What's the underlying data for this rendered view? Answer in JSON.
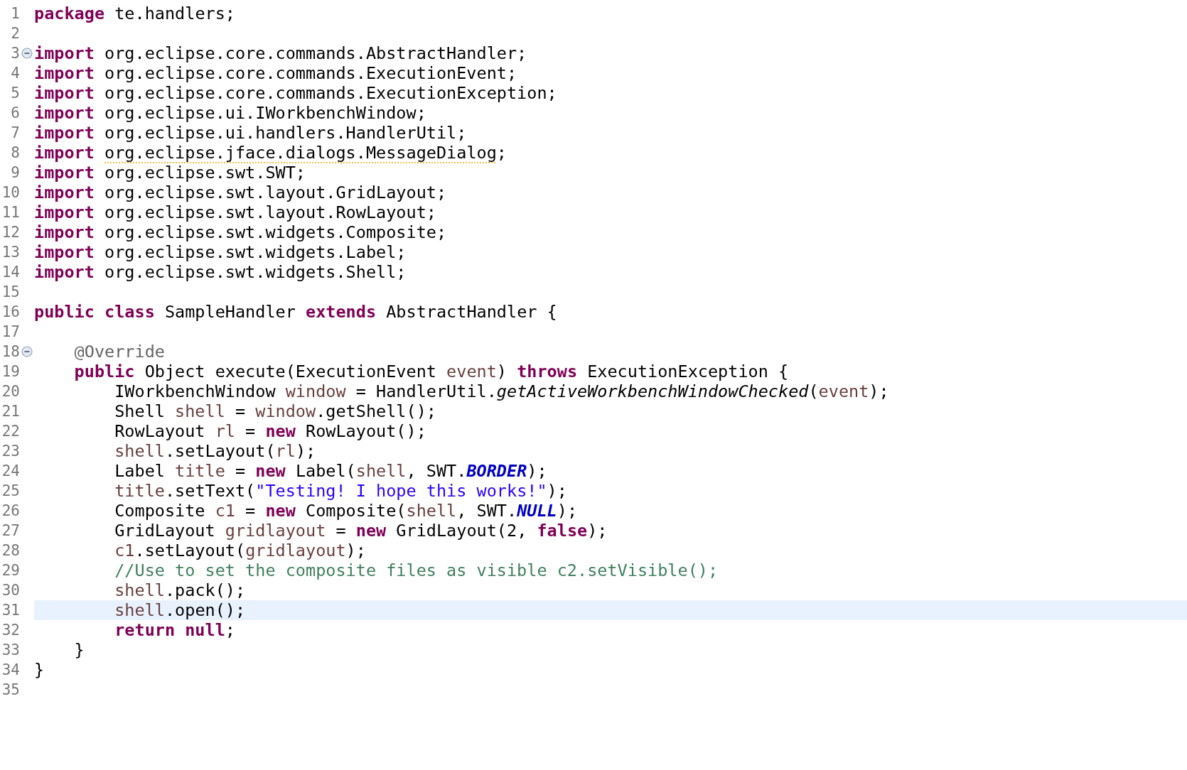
{
  "editor": {
    "lines": [
      {
        "number": "1",
        "fold": false,
        "current": false,
        "tokens": [
          {
            "kind": "keyword",
            "text": "package"
          },
          {
            "kind": "plain",
            "text": " te.handlers;"
          }
        ]
      },
      {
        "number": "2",
        "fold": false,
        "current": false
      },
      {
        "number": "3",
        "fold": true,
        "current": false,
        "tokens": [
          {
            "kind": "keyword",
            "text": "import"
          },
          {
            "kind": "plain",
            "text": " org.eclipse.core.commands.AbstractHandler;"
          }
        ]
      },
      {
        "number": "4",
        "fold": false,
        "current": false,
        "tokens": [
          {
            "kind": "keyword",
            "text": "import"
          },
          {
            "kind": "plain",
            "text": " org.eclipse.core.commands.ExecutionEvent;"
          }
        ]
      },
      {
        "number": "5",
        "fold": false,
        "current": false,
        "tokens": [
          {
            "kind": "keyword",
            "text": "import"
          },
          {
            "kind": "plain",
            "text": " org.eclipse.core.commands.ExecutionException;"
          }
        ]
      },
      {
        "number": "6",
        "fold": false,
        "current": false,
        "tokens": [
          {
            "kind": "keyword",
            "text": "import"
          },
          {
            "kind": "plain",
            "text": " org.eclipse.ui.IWorkbenchWindow;"
          }
        ]
      },
      {
        "number": "7",
        "fold": false,
        "current": false,
        "tokens": [
          {
            "kind": "keyword",
            "text": "import"
          },
          {
            "kind": "plain",
            "text": " org.eclipse.ui.handlers.HandlerUtil;"
          }
        ]
      },
      {
        "number": "8",
        "fold": false,
        "current": false,
        "tokens": [
          {
            "kind": "keyword",
            "text": "import "
          },
          {
            "kind": "warning",
            "text": "org.eclipse.jface.dialogs.MessageDialog"
          },
          {
            "kind": "plain",
            "text": ";"
          }
        ]
      },
      {
        "number": "9",
        "fold": false,
        "current": false,
        "tokens": [
          {
            "kind": "keyword",
            "text": "import"
          },
          {
            "kind": "plain",
            "text": " org.eclipse.swt.SWT;"
          }
        ]
      },
      {
        "number": "10",
        "fold": false,
        "current": false,
        "tokens": [
          {
            "kind": "keyword",
            "text": "import"
          },
          {
            "kind": "plain",
            "text": " org.eclipse.swt.layout.GridLayout;"
          }
        ]
      },
      {
        "number": "11",
        "fold": false,
        "current": false,
        "tokens": [
          {
            "kind": "keyword",
            "text": "import"
          },
          {
            "kind": "plain",
            "text": " org.eclipse.swt.layout.RowLayout;"
          }
        ]
      },
      {
        "number": "12",
        "fold": false,
        "current": false,
        "tokens": [
          {
            "kind": "keyword",
            "text": "import"
          },
          {
            "kind": "plain",
            "text": " org.eclipse.swt.widgets.Composite;"
          }
        ]
      },
      {
        "number": "13",
        "fold": false,
        "current": false,
        "tokens": [
          {
            "kind": "keyword",
            "text": "import"
          },
          {
            "kind": "plain",
            "text": " org.eclipse.swt.widgets.Label;"
          }
        ]
      },
      {
        "number": "14",
        "fold": false,
        "current": false,
        "tokens": [
          {
            "kind": "keyword",
            "text": "import"
          },
          {
            "kind": "plain",
            "text": " org.eclipse.swt.widgets.Shell;"
          }
        ]
      },
      {
        "number": "15",
        "fold": false,
        "current": false
      },
      {
        "number": "16",
        "fold": false,
        "current": false,
        "tokens": [
          {
            "kind": "keyword",
            "text": "public class"
          },
          {
            "kind": "plain",
            "text": " SampleHandler "
          },
          {
            "kind": "keyword",
            "text": "extends"
          },
          {
            "kind": "plain",
            "text": " AbstractHandler {"
          }
        ]
      },
      {
        "number": "17",
        "fold": false,
        "current": false
      },
      {
        "number": "18",
        "fold": true,
        "current": false,
        "tokens": [
          {
            "kind": "annotation",
            "text": "    @Override"
          }
        ]
      },
      {
        "number": "19",
        "fold": false,
        "current": false,
        "tokens": [
          {
            "kind": "keyword",
            "text": "    public"
          },
          {
            "kind": "plain",
            "text": " Object execute(ExecutionEvent "
          },
          {
            "kind": "variable",
            "text": "event"
          },
          {
            "kind": "plain",
            "text": ") "
          },
          {
            "kind": "keyword",
            "text": "throws"
          },
          {
            "kind": "plain",
            "text": " ExecutionException {"
          }
        ]
      },
      {
        "number": "20",
        "fold": false,
        "current": false,
        "tokens": [
          {
            "kind": "plain",
            "text": "        IWorkbenchWindow "
          },
          {
            "kind": "variable",
            "text": "window"
          },
          {
            "kind": "plain",
            "text": " = HandlerUtil."
          },
          {
            "kind": "method",
            "text": "getActiveWorkbenchWindowChecked"
          },
          {
            "kind": "plain",
            "text": "("
          },
          {
            "kind": "variable",
            "text": "event"
          },
          {
            "kind": "plain",
            "text": ");"
          }
        ]
      },
      {
        "number": "21",
        "fold": false,
        "current": false,
        "tokens": [
          {
            "kind": "plain",
            "text": "        Shell "
          },
          {
            "kind": "variable",
            "text": "shell"
          },
          {
            "kind": "plain",
            "text": " = "
          },
          {
            "kind": "variable",
            "text": "window"
          },
          {
            "kind": "plain",
            "text": ".getShell();"
          }
        ]
      },
      {
        "number": "22",
        "fold": false,
        "current": false,
        "tokens": [
          {
            "kind": "plain",
            "text": "        RowLayout "
          },
          {
            "kind": "variable",
            "text": "rl"
          },
          {
            "kind": "plain",
            "text": " = "
          },
          {
            "kind": "keyword",
            "text": "new"
          },
          {
            "kind": "plain",
            "text": " RowLayout();"
          }
        ]
      },
      {
        "number": "23",
        "fold": false,
        "current": false,
        "tokens": [
          {
            "kind": "variable",
            "text": "        shell"
          },
          {
            "kind": "plain",
            "text": ".setLayout("
          },
          {
            "kind": "variable",
            "text": "rl"
          },
          {
            "kind": "plain",
            "text": ");"
          }
        ]
      },
      {
        "number": "24",
        "fold": false,
        "current": false,
        "tokens": [
          {
            "kind": "plain",
            "text": "        Label "
          },
          {
            "kind": "variable",
            "text": "title"
          },
          {
            "kind": "plain",
            "text": " = "
          },
          {
            "kind": "keyword",
            "text": "new"
          },
          {
            "kind": "plain",
            "text": " Label("
          },
          {
            "kind": "variable",
            "text": "shell"
          },
          {
            "kind": "plain",
            "text": ", SWT."
          },
          {
            "kind": "constant",
            "text": "BORDER"
          },
          {
            "kind": "plain",
            "text": ");"
          }
        ]
      },
      {
        "number": "25",
        "fold": false,
        "current": false,
        "tokens": [
          {
            "kind": "variable",
            "text": "        title"
          },
          {
            "kind": "plain",
            "text": ".setText("
          },
          {
            "kind": "string",
            "text": "\"Testing! I hope this works!\""
          },
          {
            "kind": "plain",
            "text": ");"
          }
        ]
      },
      {
        "number": "26",
        "fold": false,
        "current": false,
        "tokens": [
          {
            "kind": "plain",
            "text": "        Composite "
          },
          {
            "kind": "variable",
            "text": "c1"
          },
          {
            "kind": "plain",
            "text": " = "
          },
          {
            "kind": "keyword",
            "text": "new"
          },
          {
            "kind": "plain",
            "text": " Composite("
          },
          {
            "kind": "variable",
            "text": "shell"
          },
          {
            "kind": "plain",
            "text": ", SWT."
          },
          {
            "kind": "constant",
            "text": "NULL"
          },
          {
            "kind": "plain",
            "text": ");"
          }
        ]
      },
      {
        "number": "27",
        "fold": false,
        "current": false,
        "tokens": [
          {
            "kind": "plain",
            "text": "        GridLayout "
          },
          {
            "kind": "variable",
            "text": "gridlayout"
          },
          {
            "kind": "plain",
            "text": " = "
          },
          {
            "kind": "keyword",
            "text": "new"
          },
          {
            "kind": "plain",
            "text": " GridLayout(2, "
          },
          {
            "kind": "keyword",
            "text": "false"
          },
          {
            "kind": "plain",
            "text": ");"
          }
        ]
      },
      {
        "number": "28",
        "fold": false,
        "current": false,
        "tokens": [
          {
            "kind": "variable",
            "text": "        c1"
          },
          {
            "kind": "plain",
            "text": ".setLayout("
          },
          {
            "kind": "variable",
            "text": "gridlayout"
          },
          {
            "kind": "plain",
            "text": ");"
          }
        ]
      },
      {
        "number": "29",
        "fold": false,
        "current": false,
        "tokens": [
          {
            "kind": "comment",
            "text": "        //Use to set the composite files as visible c2.setVisible();"
          }
        ]
      },
      {
        "number": "30",
        "fold": false,
        "current": false,
        "tokens": [
          {
            "kind": "variable",
            "text": "        shell"
          },
          {
            "kind": "plain",
            "text": ".pack();"
          }
        ]
      },
      {
        "number": "31",
        "fold": false,
        "current": true,
        "tokens": [
          {
            "kind": "variable",
            "text": "        shell"
          },
          {
            "kind": "plain",
            "text": ".open();"
          }
        ]
      },
      {
        "number": "32",
        "fold": false,
        "current": false,
        "tokens": [
          {
            "kind": "keyword",
            "text": "        return null"
          },
          {
            "kind": "plain",
            "text": ";"
          }
        ]
      },
      {
        "number": "33",
        "fold": false,
        "current": false,
        "tokens": [
          {
            "kind": "plain",
            "text": "    }"
          }
        ]
      },
      {
        "number": "34",
        "fold": false,
        "current": false,
        "tokens": [
          {
            "kind": "plain",
            "text": "}"
          }
        ]
      },
      {
        "number": "35",
        "fold": false,
        "current": false
      }
    ]
  }
}
